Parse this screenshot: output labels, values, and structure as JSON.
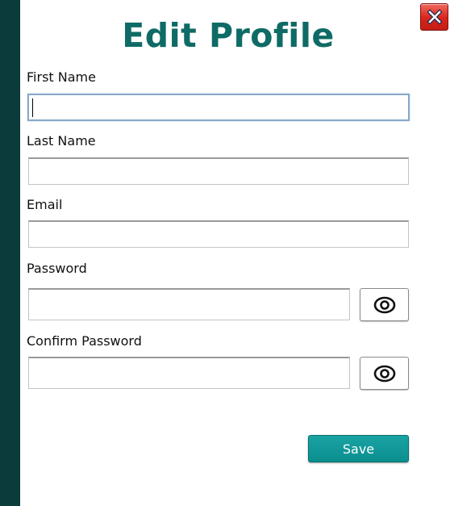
{
  "form": {
    "title": "Edit Profile",
    "first_name": {
      "label": "First Name",
      "value": ""
    },
    "last_name": {
      "label": "Last Name",
      "value": ""
    },
    "email": {
      "label": "Email",
      "value": ""
    },
    "password": {
      "label": "Password",
      "value": ""
    },
    "confirm_password": {
      "label": "Confirm Password",
      "value": ""
    },
    "save_label": "Save"
  },
  "icons": {
    "close": "close-icon",
    "show_password": "eye-icon",
    "show_confirm_password": "eye-icon"
  },
  "colors": {
    "title": "#0e6b66",
    "side_strip": "#0b3b3b",
    "save_button": "#0a8e8e",
    "close_button": "#d9241a"
  }
}
